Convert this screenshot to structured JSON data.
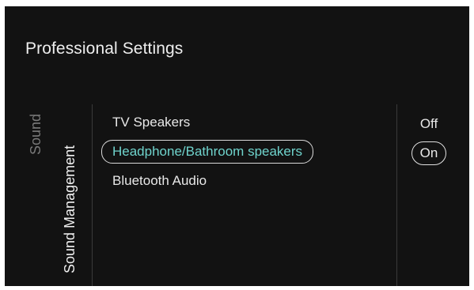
{
  "header": {
    "title": "Professional Settings"
  },
  "breadcrumb": {
    "parent": "Sound",
    "current": "Sound Management"
  },
  "menu": {
    "items": [
      {
        "label": "TV Speakers",
        "selected": false
      },
      {
        "label": "Headphone/Bathroom speakers",
        "selected": true
      },
      {
        "label": "Bluetooth Audio",
        "selected": false
      }
    ]
  },
  "options": {
    "items": [
      {
        "label": "Off",
        "selected": false
      },
      {
        "label": "On",
        "selected": true
      }
    ]
  },
  "colors": {
    "background": "#121212",
    "text": "#e8e8e8",
    "muted": "#7a7a7a",
    "highlight": "#6fd3cc"
  }
}
